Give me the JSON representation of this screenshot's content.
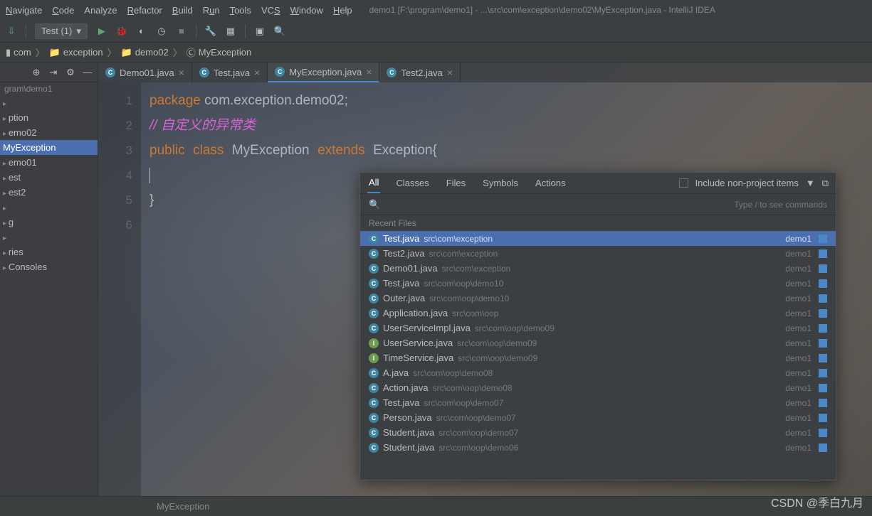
{
  "menu": {
    "navigate": "Navigate",
    "code": "Code",
    "analyze": "Analyze",
    "refactor": "Refactor",
    "build": "Build",
    "run": "Run",
    "tools": "Tools",
    "vcs": "VCS",
    "window": "Window",
    "help": "Help"
  },
  "title": "demo1 [F:\\program\\demo1] - ...\\src\\com\\exception\\demo02\\MyException.java - IntelliJ IDEA",
  "run_config": "Test (1)",
  "breadcrumbs": {
    "p0": "com",
    "p1": "exception",
    "p2": "demo02",
    "p3": "MyException"
  },
  "sidebar": {
    "label": "gram\\demo1",
    "items": [
      "",
      "ption",
      "emo02",
      "MyException",
      "emo01",
      "est",
      "est2",
      "",
      "g",
      "",
      "ries",
      "Consoles"
    ]
  },
  "tabs": [
    {
      "label": "Demo01.java",
      "active": false
    },
    {
      "label": "Test.java",
      "active": false
    },
    {
      "label": "MyException.java",
      "active": true
    },
    {
      "label": "Test2.java",
      "active": false
    }
  ],
  "code": {
    "lines": [
      "1",
      "2",
      "3",
      "4",
      "5",
      "6"
    ],
    "l1_kw": "package",
    "l1_rest": " com.exception.demo02;",
    "l2": "// 自定义的异常类",
    "l3_a": "public",
    "l3_b": "class",
    "l3_c": "MyException",
    "l3_d": "extends",
    "l3_e": "Exception{",
    "l5": "}"
  },
  "status": "MyException",
  "popup": {
    "tabs": {
      "all": "All",
      "classes": "Classes",
      "files": "Files",
      "symbols": "Symbols",
      "actions": "Actions"
    },
    "nonproject": "Include non-project items",
    "hint": "Type / to see commands",
    "section": "Recent Files",
    "module": "demo1",
    "items": [
      {
        "icon": "C",
        "name": "Test.java",
        "path": "src\\com\\exception",
        "selected": true
      },
      {
        "icon": "C",
        "name": "Test2.java",
        "path": "src\\com\\exception"
      },
      {
        "icon": "C",
        "name": "Demo01.java",
        "path": "src\\com\\exception"
      },
      {
        "icon": "C",
        "name": "Test.java",
        "path": "src\\com\\oop\\demo10"
      },
      {
        "icon": "C",
        "name": "Outer.java",
        "path": "src\\com\\oop\\demo10"
      },
      {
        "icon": "C",
        "name": "Application.java",
        "path": "src\\com\\oop"
      },
      {
        "icon": "C",
        "name": "UserServiceImpl.java",
        "path": "src\\com\\oop\\demo09"
      },
      {
        "icon": "I",
        "name": "UserService.java",
        "path": "src\\com\\oop\\demo09"
      },
      {
        "icon": "I",
        "name": "TimeService.java",
        "path": "src\\com\\oop\\demo09"
      },
      {
        "icon": "C",
        "name": "A.java",
        "path": "src\\com\\oop\\demo08"
      },
      {
        "icon": "C",
        "name": "Action.java",
        "path": "src\\com\\oop\\demo08"
      },
      {
        "icon": "C",
        "name": "Test.java",
        "path": "src\\com\\oop\\demo07"
      },
      {
        "icon": "C",
        "name": "Person.java",
        "path": "src\\com\\oop\\demo07"
      },
      {
        "icon": "C",
        "name": "Student.java",
        "path": "src\\com\\oop\\demo07"
      },
      {
        "icon": "C",
        "name": "Student.java",
        "path": "src\\com\\oop\\demo06"
      }
    ]
  },
  "watermark": "CSDN @季白九月"
}
